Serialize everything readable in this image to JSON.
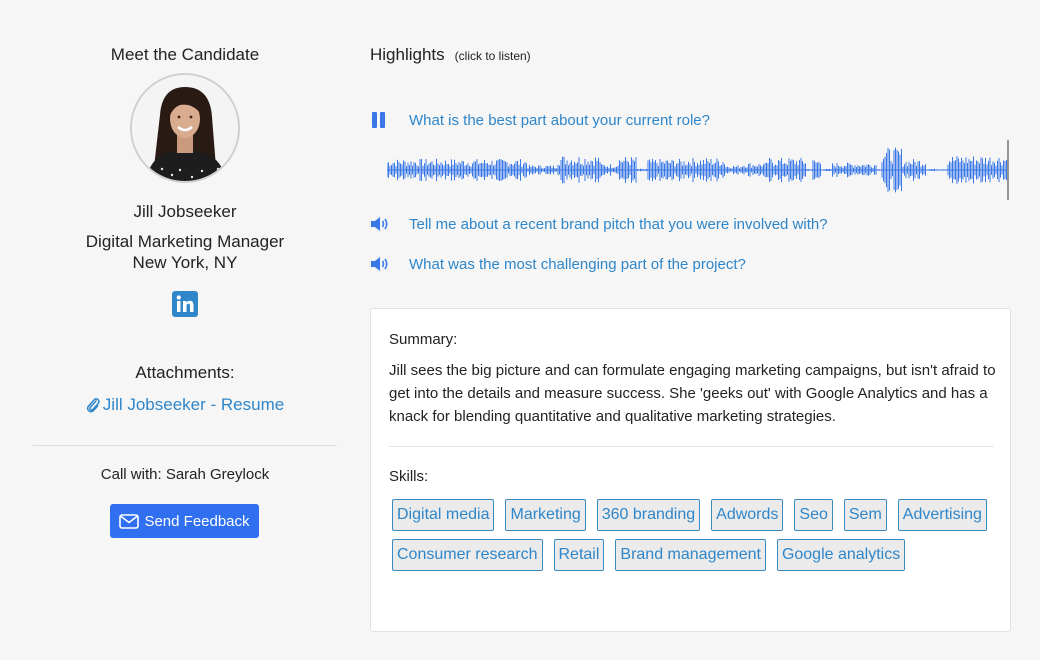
{
  "candidate": {
    "heading": "Meet the Candidate",
    "name": "Jill Jobseeker",
    "title": "Digital Marketing Manager",
    "location": "New York, NY",
    "avatar_icon": "candidate-photo",
    "social_icon": "linkedin-icon",
    "attachments_label": "Attachments:",
    "attachment_link": "Jill Jobseeker - Resume",
    "call_with": "Call with: Sarah Greylock",
    "feedback_label": "Send Feedback"
  },
  "highlights": {
    "title": "Highlights",
    "hint": "(click to listen)",
    "questions": [
      {
        "text": "What is the best part about your current role?",
        "state": "playing",
        "icon": "pause-icon"
      },
      {
        "text": "Tell me about a recent brand pitch that you were involved with?",
        "state": "idle",
        "icon": "speaker-icon"
      },
      {
        "text": "What was the most challenging part of the project?",
        "state": "idle",
        "icon": "speaker-icon"
      }
    ]
  },
  "summary": {
    "label": "Summary:",
    "text": "Jill sees the big picture and can formulate engaging marketing campaigns, but isn't afraid to get into the details and measure success. She 'geeks out' with Google Analytics and has a knack for blending quantitative and qualitative marketing strategies."
  },
  "skills": {
    "label": "Skills:",
    "items": [
      "Digital media",
      "Marketing",
      "360 branding",
      "Adwords",
      "Seo",
      "Sem",
      "Advertising",
      "Consumer research",
      "Retail",
      "Brand management",
      "Google analytics"
    ]
  },
  "colors": {
    "accent": "#2f6ff0",
    "link": "#2f86c9",
    "waveform": "#3a78e8"
  }
}
